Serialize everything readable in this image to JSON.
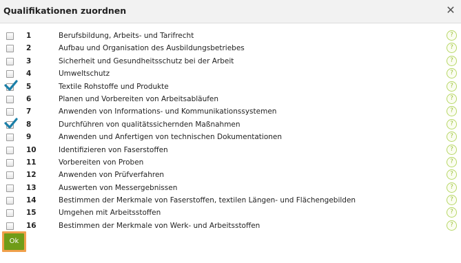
{
  "dialog": {
    "title": "Qualifikationen zuordnen",
    "close_icon": "close-icon",
    "ok_label": "Ok"
  },
  "qualifications": [
    {
      "num": "1",
      "label": "Berufsbildung, Arbeits- und Tarifrecht",
      "checked": false
    },
    {
      "num": "2",
      "label": "Aufbau und Organisation des Ausbildungsbetriebes",
      "checked": false
    },
    {
      "num": "3",
      "label": "Sicherheit und Gesundheitsschutz bei der Arbeit",
      "checked": false
    },
    {
      "num": "4",
      "label": "Umweltschutz",
      "checked": false
    },
    {
      "num": "5",
      "label": "Textile Rohstoffe und Produkte",
      "checked": true
    },
    {
      "num": "6",
      "label": "Planen und Vorbereiten von Arbeitsabläufen",
      "checked": false
    },
    {
      "num": "7",
      "label": "Anwenden von Informations- und Kommunikationssystemen",
      "checked": false
    },
    {
      "num": "8",
      "label": "Durchführen von qualitätssichernden Maßnahmen",
      "checked": true
    },
    {
      "num": "9",
      "label": "Anwenden und Anfertigen von technischen Dokumentationen",
      "checked": false
    },
    {
      "num": "10",
      "label": "Identifizieren von Faserstoffen",
      "checked": false
    },
    {
      "num": "11",
      "label": "Vorbereiten von Proben",
      "checked": false
    },
    {
      "num": "12",
      "label": "Anwenden von Prüfverfahren",
      "checked": false
    },
    {
      "num": "13",
      "label": "Auswerten von Messergebnissen",
      "checked": false
    },
    {
      "num": "14",
      "label": "Bestimmen der Merkmale von Faserstoffen, textilen Längen- und Flächengebilden",
      "checked": false
    },
    {
      "num": "15",
      "label": "Umgehen mit Arbeitsstoffen",
      "checked": false
    },
    {
      "num": "16",
      "label": "Bestimmen der Merkmale von Werk- und Arbeitsstoffen",
      "checked": false
    }
  ],
  "help_glyph": "?",
  "colors": {
    "ok_button": "#6f9c18",
    "ok_focus_ring": "#f0a04b",
    "checkmark": "#1a7fa8",
    "help_icon": "#9ec23a"
  }
}
